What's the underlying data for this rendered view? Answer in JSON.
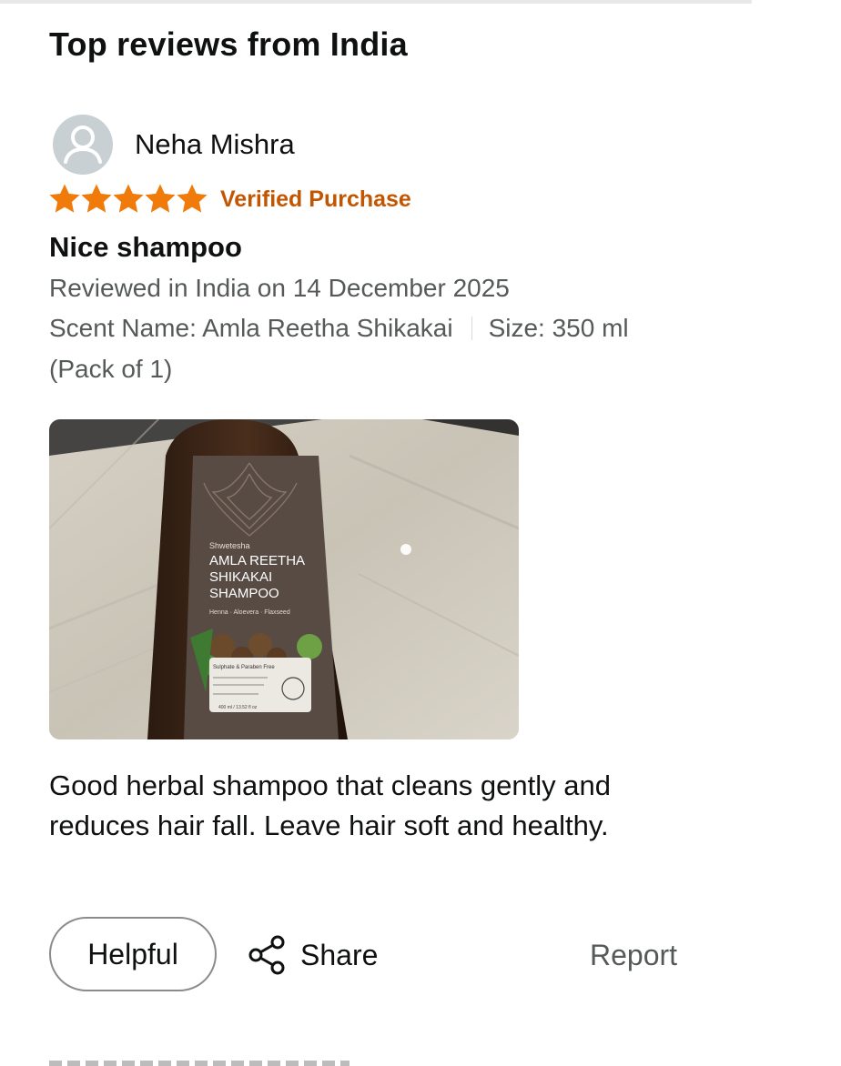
{
  "section": {
    "title": "Top reviews from India"
  },
  "review": {
    "reviewer_name": "Neha Mishra",
    "avatar_icon": "user-silhouette-icon",
    "rating": 5,
    "rating_max": 5,
    "star_icon": "star-icon",
    "star_color": "#f07a0a",
    "verified_label": "Verified Purchase",
    "verified_color": "#c45500",
    "title": "Nice shampoo",
    "date_text": "Reviewed in India on 14 December 2025",
    "scent_text": "Scent Name: Amla Reetha Shikakai",
    "size_text": "Size: 350 ml",
    "pack_text": "(Pack of 1)",
    "photo": {
      "brand": "Shwetesha",
      "product_lines": [
        "AMLA REETHA",
        "SHIKAKAI",
        "SHAMPOO"
      ],
      "sub_line": "Henna · Aloevera · Flaxseed",
      "badge": "Sulphate & Paraben Free",
      "volume": "400 ml / 13.52 fl oz"
    },
    "body": "Good herbal shampoo that cleans gently and reduces hair fall. Leave hair soft and healthy."
  },
  "actions": {
    "helpful_label": "Helpful",
    "share_label": "Share",
    "share_icon": "share-icon",
    "report_label": "Report"
  }
}
